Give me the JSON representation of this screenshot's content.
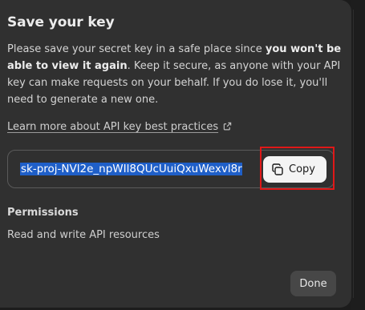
{
  "dialog": {
    "title": "Save your key",
    "description_part1": "Please save your secret key in a safe place since ",
    "description_bold": "you won't be able to view it again",
    "description_part2": ". Keep it secure, as anyone with your API key can make requests on your behalf. If you do lose it, you'll need to generate a new one.",
    "learn_more_link": "Learn more about API key best practices",
    "secret_key": "sk-proj-NVl2e_npWIl8QUcUuiQxuWexvl8r",
    "copy_button_label": "Copy",
    "permissions_heading": "Permissions",
    "permissions_value": "Read and write API resources",
    "done_button_label": "Done"
  },
  "icons": {
    "external_link": "external-link-icon",
    "copy": "copy-icon"
  },
  "colors": {
    "modal_background": "#303030",
    "selection_highlight": "#1f5fc8",
    "annotation_box": "#e01818",
    "copy_button_bg": "#f4f4f4",
    "done_button_bg": "#474747"
  }
}
